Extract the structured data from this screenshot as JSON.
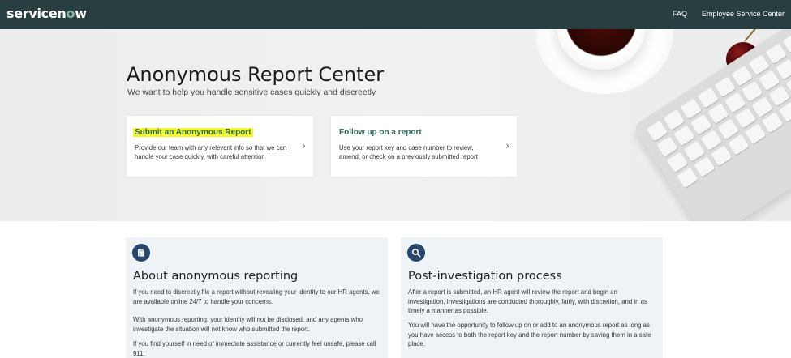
{
  "header": {
    "logo_text_pre": "servicen",
    "logo_text_o": "o",
    "logo_text_post": "w",
    "nav": [
      "FAQ",
      "Employee Service Center"
    ]
  },
  "hero": {
    "title": "Anonymous Report Center",
    "subtitle": "We want to help you handle sensitive cases quickly and discreetly"
  },
  "cards": [
    {
      "title": "Submit an Anonymous Report",
      "description": "Provide our team with any relevant info so that we can handle your case quickly, with careful attention",
      "highlighted": true
    },
    {
      "title": "Follow up on a report",
      "description": "Use your report key and case number to review, amend, or check on a previously submitted report",
      "highlighted": false
    }
  ],
  "panels": [
    {
      "icon": "document-icon",
      "title": "About anonymous reporting",
      "paragraphs": [
        "If you need to discreetly file a report without revealing your identity to our HR agents, we are available online 24/7 to handle your concerns.",
        "With anonymous reporting, your identity will not be disclosed, and any agents who investigate the situation will not know who submitted the report.",
        "If you find yourself in need of immediate assistance or currently feel unsafe, please call 911."
      ]
    },
    {
      "icon": "search-icon",
      "title": "Post-investigation process",
      "paragraphs": [
        "After a report is submitted, an HR agent will review the report and begin an investigation. Investigations are conducted thoroughly, fairly, with discretion, and in as timely a manner as possible.",
        "You will have the opportunity to follow up on or add to an anonymous report as long as you have access to both the report key and the report number by saving them in a safe place."
      ]
    }
  ],
  "colors": {
    "topbar": "#293e40",
    "card_title": "#2e6b56",
    "highlight": "#f4f52a",
    "panel_bg": "#eef3f8",
    "panel_icon_bg": "#27466a"
  }
}
